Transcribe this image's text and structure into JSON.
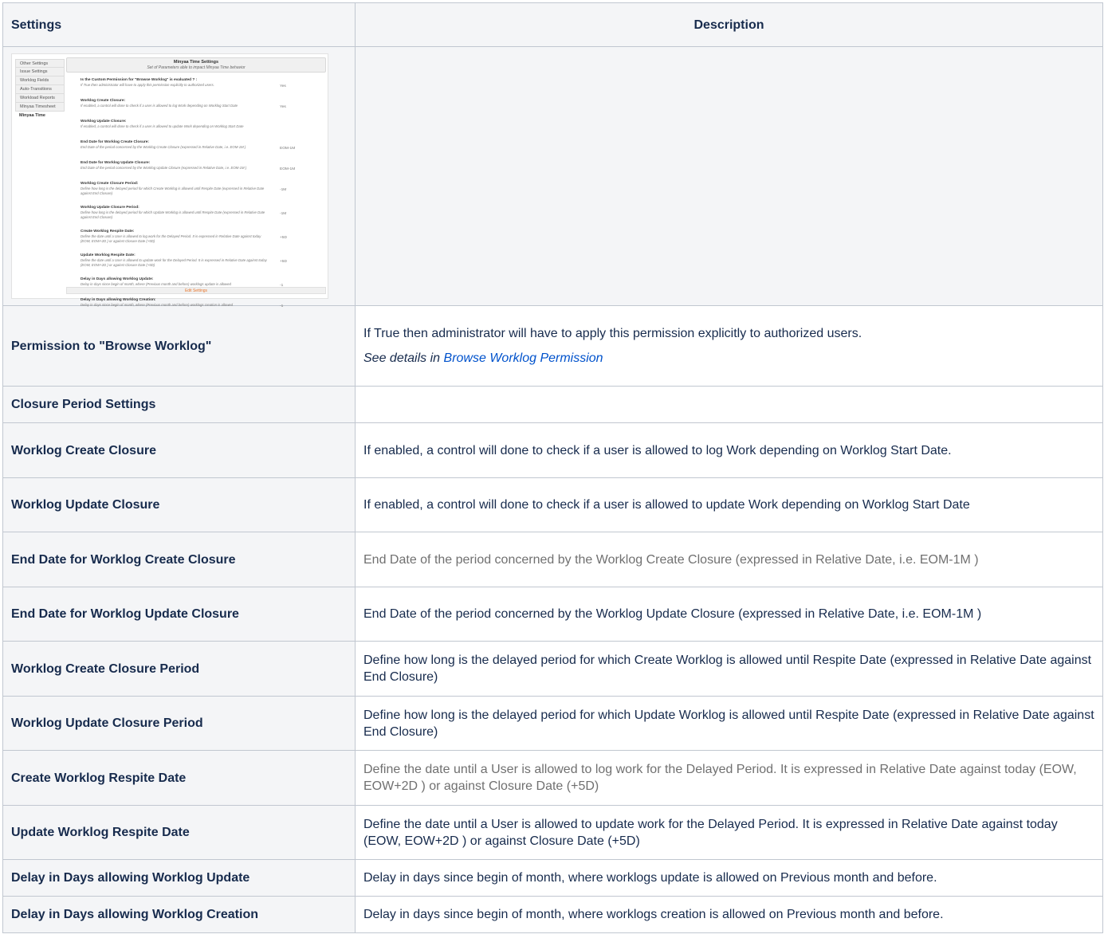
{
  "header": {
    "settings": "Settings",
    "description": "Description"
  },
  "thumbnail": {
    "nav": [
      "Other Settings",
      "Issue Settings",
      "Worklog Fields",
      "Auto-Transitions",
      "Workload Reports",
      "Minyaa Timesheet",
      "Minyaa Time"
    ],
    "title": "Minyaa Time Settings",
    "subtitle": "Set of Parameters able to impact Minyaa Time behavior",
    "rows": [
      {
        "label": "Is the Custom Permission for \"Browse Worklog\" is evaluated ? :",
        "sub": "If True then administrator will have to apply this permission explicitly to authorized users.",
        "value": "Yes"
      },
      {
        "label": "Worklog Create Closure:",
        "sub": "If enabled, a control will done to check if a user is allowed to log Work depending on Worklog Start Date",
        "value": "Yes"
      },
      {
        "label": "Worklog Update Closure:",
        "sub": "If enabled, a control will done to check if a user is allowed to update Work depending on Worklog Start Date",
        "value": ""
      },
      {
        "label": "End Date for Worklog Create Closure:",
        "sub": "End Date of the period concerned by the Worklog Create Closure (expressed in Relative Date, i.e. EOM-1M )",
        "value": "EOM-1M"
      },
      {
        "label": "End Date for Worklog Update Closure:",
        "sub": "End Date of the period concerned by the Worklog Update Closure (expressed in Relative Date, i.e. EOM-1M )",
        "value": "EOM-1M"
      },
      {
        "label": "Worklog Create Closure Period:",
        "sub": "Define how long is the delayed period for which Create Worklog is allowed until Respite Date (expressed in Relative Date against End Closure)",
        "value": "-1M"
      },
      {
        "label": "Worklog Update Closure Period:",
        "sub": "Define how long is the delayed period for which Update Worklog is allowed until Respite Date (expressed in Relative Date against End Closure)",
        "value": "-1M"
      },
      {
        "label": "Create Worklog Respite Date:",
        "sub": "Define the date until a User is allowed to log work for the Delayed Period. It is expressed in Relative Date against today (EOW, EOW+2D ) or against Closure Date (+5D)",
        "value": "+5D"
      },
      {
        "label": "Update Worklog Respite Date:",
        "sub": "Define the date until a User is allowed to update work for the Delayed Period. It is expressed in Relative Date against today (EOW, EOW+2D ) or against Closure Date (+5D)",
        "value": "+5D"
      },
      {
        "label": "Delay in Days allowing Worklog Update:",
        "sub": "Delay in days since begin of month, where (Previous month and before) worklogs update is allowed",
        "value": "-1"
      },
      {
        "label": "Delay in Days allowing Worklog Creation:",
        "sub": "Delay in days since begin of month, where (Previous month and before) worklogs creation is allowed",
        "value": "-1"
      }
    ],
    "edit_label": "Edit Settings"
  },
  "rows": [
    {
      "name": "Permission to \"Browse Worklog\"",
      "desc": "If True then administrator will have to apply this permission explicitly to authorized users.",
      "note_prefix": "See details in ",
      "note_link": "Browse Worklog Permission"
    },
    {
      "name": "Closure Period Settings",
      "desc": ""
    },
    {
      "name": "Worklog Create Closure",
      "desc": "If enabled, a control will done to check if a user is allowed to log Work depending on Worklog Start Date."
    },
    {
      "name": "Worklog Update Closure",
      "desc": "If enabled, a control will done to check if a user is allowed to update Work depending on Worklog Start Date"
    },
    {
      "name": "End Date for Worklog Create Closure",
      "desc": "End Date of the period concerned by the Worklog Create Closure (expressed in Relative Date, i.e. EOM-1M )"
    },
    {
      "name": "End Date for Worklog Update Closure",
      "desc": "End Date of the period concerned by the Worklog Update Closure (expressed in Relative Date, i.e. EOM-1M )"
    },
    {
      "name": "Worklog Create Closure Period",
      "desc": "Define how long is the delayed period for which Create Worklog is allowed until Respite Date (expressed in Relative Date against End Closure)"
    },
    {
      "name": "Worklog Update Closure Period",
      "desc": "Define how long is the delayed period for which Update Worklog is allowed until Respite Date (expressed in Relative Date against End Closure)"
    },
    {
      "name": "Create Worklog Respite Date",
      "desc": "Define the date until a User is allowed to log work for the Delayed Period. It is expressed in Relative Date against today (EOW, EOW+2D ) or against Closure Date (+5D)"
    },
    {
      "name": "Update Worklog Respite Date",
      "desc": "Define the date until a User is allowed to update work for the Delayed Period. It is expressed in Relative Date against today (EOW, EOW+2D ) or against Closure Date (+5D)"
    },
    {
      "name": "Delay in Days allowing Worklog Update",
      "desc": "Delay in days since begin of month, where worklogs update is allowed on Previous month and before."
    },
    {
      "name": "Delay in Days allowing Worklog Creation",
      "desc": "Delay in days since begin of month, where worklogs creation is allowed on Previous month and before."
    }
  ],
  "colors": {
    "link": "#0052cc",
    "header_bg": "#f4f5f7",
    "border": "#c1c7d0",
    "muted_text": "#707070"
  }
}
